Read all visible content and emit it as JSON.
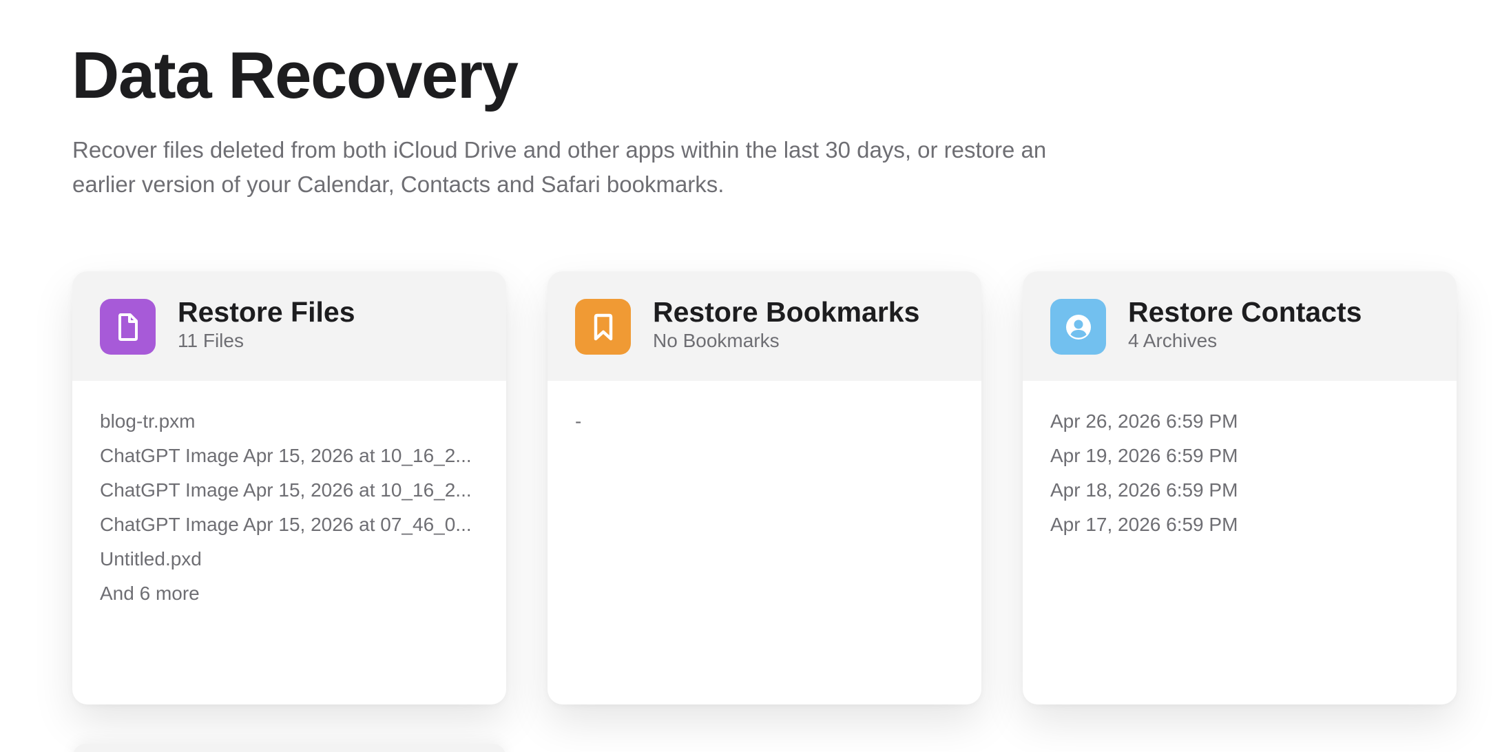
{
  "page": {
    "title": "Data Recovery",
    "description": "Recover files deleted from both iCloud Drive and other apps within the last 30 days, or restore an earlier version of your Calendar, Contacts and Safari bookmarks."
  },
  "cards": {
    "files": {
      "title": "Restore Files",
      "subtitle": "11 Files",
      "icon": "document-icon",
      "icon_color": "#a75ad8",
      "items": [
        "blog-tr.pxm",
        "ChatGPT Image Apr 15, 2026 at 10_16_2...",
        "ChatGPT Image Apr 15, 2026 at 10_16_2...",
        "ChatGPT Image Apr 15, 2026 at 07_46_0...",
        "Untitled.pxd",
        "And 6 more"
      ]
    },
    "bookmarks": {
      "title": "Restore Bookmarks",
      "subtitle": "No Bookmarks",
      "icon": "bookmark-icon",
      "icon_color": "#f09a34",
      "items": [
        "-"
      ]
    },
    "contacts": {
      "title": "Restore Contacts",
      "subtitle": "4 Archives",
      "icon": "contact-icon",
      "icon_color": "#72c0ef",
      "items": [
        "Apr 26, 2026 6:59 PM",
        "Apr 19, 2026 6:59 PM",
        "Apr 18, 2026 6:59 PM",
        "Apr 17, 2026 6:59 PM"
      ]
    }
  }
}
